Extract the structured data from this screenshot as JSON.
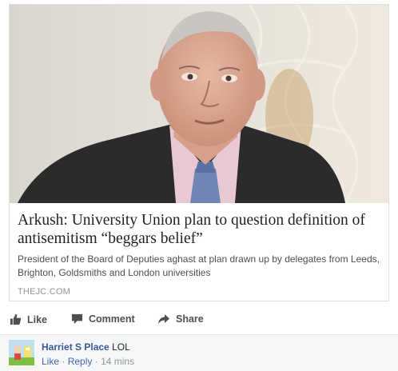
{
  "post": {
    "headline": "Arkush: University Union plan to question definition of antisemitism “beggars belief”",
    "description": "President of the Board of Deputies aghast at plan drawn up by delegates from Leeds, Brighton, Goldsmiths and London universities",
    "domain": "THEJC.COM"
  },
  "actions": {
    "like": "Like",
    "comment": "Comment",
    "share": "Share"
  },
  "comment": {
    "author": "Harriet S Place",
    "text": "LOL",
    "like": "Like",
    "separator": "·",
    "reply": "Reply",
    "time": "14 mins"
  },
  "colors": {
    "link_blue": "#365899",
    "action_grey": "#4b4f56",
    "meta_grey": "#90949c",
    "comment_bg": "#f6f7f9"
  }
}
